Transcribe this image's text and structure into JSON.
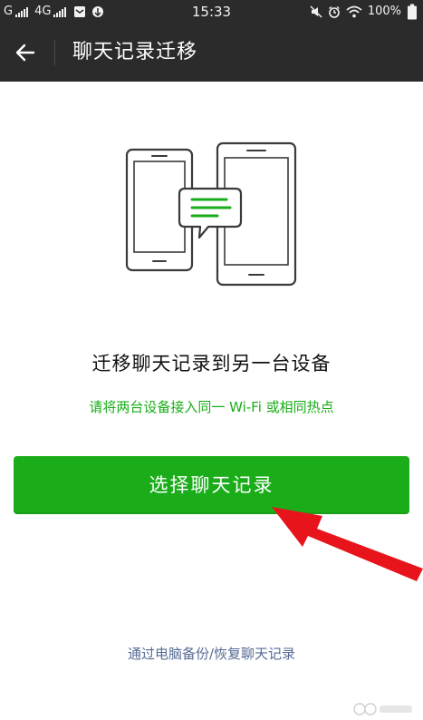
{
  "status_bar": {
    "carrier1": "G",
    "carrier2": "4G",
    "time": "15:33",
    "battery": "100%"
  },
  "nav": {
    "title": "聊天记录迁移"
  },
  "main": {
    "heading": "迁移聊天记录到另一台设备",
    "hint": "请将两台设备接入同一 Wi-Fi 或相同热点",
    "primary_button": "选择聊天记录",
    "backup_link": "通过电脑备份/恢复聊天记录"
  },
  "colors": {
    "bar_bg": "#2b2b2b",
    "accent_green": "#1aad19",
    "link_blue": "#576b95",
    "annotation_arrow": "#e8141c"
  }
}
